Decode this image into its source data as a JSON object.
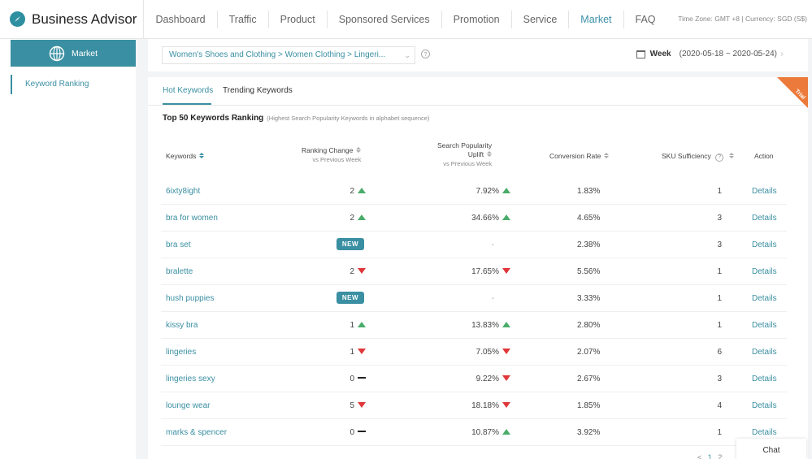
{
  "brand": {
    "title": "Business Advisor"
  },
  "nav": {
    "items": [
      "Dashboard",
      "Traffic",
      "Product",
      "Sponsored Services",
      "Promotion",
      "Service",
      "Market",
      "FAQ"
    ],
    "active": "Market",
    "timezone": "Time Zone: GMT +8 | Currency: SGD (S$)"
  },
  "sidebar": {
    "section": "Market",
    "items": [
      "Keyword Ranking"
    ]
  },
  "filter": {
    "category": "Women's Shoes and Clothing  >  Women Clothing  >  Lingeri...",
    "period_label": "Week",
    "period_range": "(2020-05-18 ~ 2020-05-24)"
  },
  "tabs": [
    "Hot Keywords",
    "Trending Keywords"
  ],
  "trial_badge": "Trial",
  "table": {
    "title": "Top 50 Keywords Ranking",
    "subtitle": "(Highest Search Popularity Keywords in alphabet sequence)",
    "headers": {
      "keywords": "Keywords",
      "ranking_change": "Ranking Change",
      "ranking_change_sub": "vs Previous Week",
      "search_pop": "Search Popularity",
      "search_pop_2": "Uplift",
      "search_pop_sub": "vs Previous Week",
      "conversion": "Conversion Rate",
      "sku": "SKU Sufficiency",
      "action": "Action"
    },
    "rows": [
      {
        "keyword": "6ixty8ight",
        "rank": "2",
        "rank_dir": "up",
        "uplift": "7.92%",
        "uplift_dir": "up",
        "conv": "1.83%",
        "sku": "1",
        "action": "Details"
      },
      {
        "keyword": "bra for women",
        "rank": "2",
        "rank_dir": "up",
        "uplift": "34.66%",
        "uplift_dir": "up",
        "conv": "4.65%",
        "sku": "3",
        "action": "Details"
      },
      {
        "keyword": "bra set",
        "rank": "NEW",
        "rank_dir": "new",
        "uplift": "-",
        "uplift_dir": "none",
        "conv": "2.38%",
        "sku": "3",
        "action": "Details"
      },
      {
        "keyword": "bralette",
        "rank": "2",
        "rank_dir": "down",
        "uplift": "17.65%",
        "uplift_dir": "down",
        "conv": "5.56%",
        "sku": "1",
        "action": "Details"
      },
      {
        "keyword": "hush puppies",
        "rank": "NEW",
        "rank_dir": "new",
        "uplift": "-",
        "uplift_dir": "none",
        "conv": "3.33%",
        "sku": "1",
        "action": "Details"
      },
      {
        "keyword": "kissy bra",
        "rank": "1",
        "rank_dir": "up",
        "uplift": "13.83%",
        "uplift_dir": "up",
        "conv": "2.80%",
        "sku": "1",
        "action": "Details"
      },
      {
        "keyword": "lingeries",
        "rank": "1",
        "rank_dir": "down",
        "uplift": "7.05%",
        "uplift_dir": "down",
        "conv": "2.07%",
        "sku": "6",
        "action": "Details"
      },
      {
        "keyword": "lingeries sexy",
        "rank": "0",
        "rank_dir": "flat",
        "uplift": "9.22%",
        "uplift_dir": "down",
        "conv": "2.67%",
        "sku": "3",
        "action": "Details"
      },
      {
        "keyword": "lounge wear",
        "rank": "5",
        "rank_dir": "down",
        "uplift": "18.18%",
        "uplift_dir": "down",
        "conv": "1.85%",
        "sku": "4",
        "action": "Details"
      },
      {
        "keyword": "marks & spencer",
        "rank": "0",
        "rank_dir": "flat",
        "uplift": "10.87%",
        "uplift_dir": "up",
        "conv": "3.92%",
        "sku": "1",
        "action": "Details"
      }
    ]
  },
  "pagination": {
    "prev": "<",
    "page1": "1",
    "page2": "2"
  },
  "chat": {
    "label": "Chat"
  },
  "colors": {
    "accent": "#3a8fa2",
    "up": "#4aac6a",
    "down": "#e0373a",
    "trial": "#ec7a3a"
  }
}
